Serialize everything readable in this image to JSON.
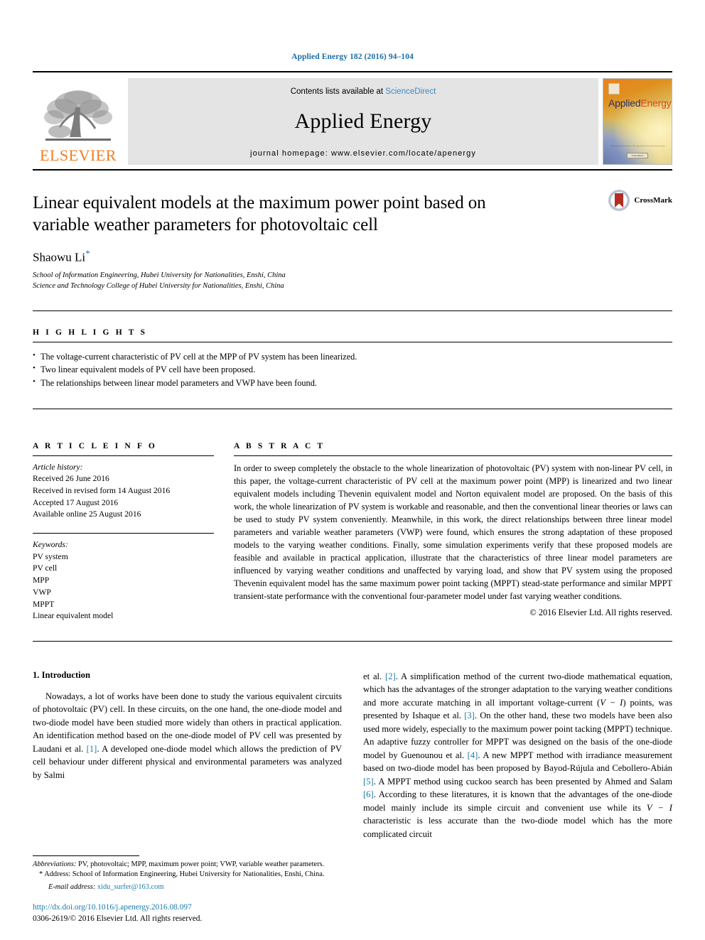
{
  "running_head": "Applied Energy 182 (2016) 94–104",
  "masthead": {
    "publisher_name": "ELSEVIER",
    "contents_prefix": "Contents lists available at ",
    "sciencedirect": "ScienceDirect",
    "journal_name": "Applied Energy",
    "homepage": "journal homepage: www.elsevier.com/locate/apenergy",
    "cover_title_part1": "Applied",
    "cover_title_part2": "Energy",
    "cover_footer_line1": "An International Journal of Energy Conversion and Conservation",
    "cover_footer_line2": "ScienceDirect"
  },
  "article": {
    "title": "Linear equivalent models at the maximum power point based on variable weather parameters for photovoltaic cell",
    "author": "Shaowu Li",
    "author_marker": "*",
    "affiliations": [
      "School of Information Engineering, Hubei University for Nationalities, Enshi, China",
      "Science and Technology College of Hubei University for Nationalities, Enshi, China"
    ],
    "crossmark_label": "CrossMark"
  },
  "highlights": {
    "heading": "H I G H L I G H T S",
    "items": [
      "The voltage-current characteristic of PV cell at the MPP of PV system has been linearized.",
      "Two linear equivalent models of PV cell have been proposed.",
      "The relationships between linear model parameters and VWP have been found."
    ]
  },
  "article_info": {
    "heading": "A R T I C L E   I N F O",
    "history_label": "Article history:",
    "history": [
      "Received 26 June 2016",
      "Received in revised form 14 August 2016",
      "Accepted 17 August 2016",
      "Available online 25 August 2016"
    ],
    "keywords_label": "Keywords:",
    "keywords": [
      "PV system",
      "PV cell",
      "MPP",
      "VWP",
      "MPPT",
      "Linear equivalent model"
    ]
  },
  "abstract": {
    "heading": "A B S T R A C T",
    "text": "In order to sweep completely the obstacle to the whole linearization of photovoltaic (PV) system with non-linear PV cell, in this paper, the voltage-current characteristic of PV cell at the maximum power point (MPP) is linearized and two linear equivalent models including Thevenin equivalent model and Norton equivalent model are proposed. On the basis of this work, the whole linearization of PV system is workable and reasonable, and then the conventional linear theories or laws can be used to study PV system conveniently. Meanwhile, in this work, the direct relationships between three linear model parameters and variable weather parameters (VWP) were found, which ensures the strong adaptation of these proposed models to the varying weather conditions. Finally, some simulation experiments verify that these proposed models are feasible and available in practical application, illustrate that the characteristics of three linear model parameters are influenced by varying weather conditions and unaffected by varying load, and show that PV system using the proposed Thevenin equivalent model has the same maximum power point tacking (MPPT) stead-state performance and similar MPPT transient-state performance with the conventional four-parameter model under fast varying weather conditions.",
    "copyright": "© 2016 Elsevier Ltd. All rights reserved."
  },
  "introduction": {
    "section_title": "1. Introduction",
    "left_text_a": "Nowadays, a lot of works have been done to study the various equivalent circuits of photovoltaic (PV) cell. In these circuits, on the one hand, the one-diode model and two-diode model have been studied more widely than others in practical application. An identification method based on the one-diode model of PV cell was presented by Laudani et al. ",
    "ref1": "[1]",
    "left_text_b": ". A developed one-diode model which allows the prediction of PV cell behaviour under different physical and environmental parameters was analyzed by Salmi",
    "right_text_a": "et al. ",
    "ref2": "[2]",
    "right_text_b": ". A simplification method of the current two-diode mathematical equation, which has the advantages of the stronger adaptation to the varying weather conditions and more accurate matching in all important voltage-current (",
    "formula_vi_1": "V − I",
    "right_text_c": ") points, was presented by Ishaque et al. ",
    "ref3": "[3]",
    "right_text_d": ". On the other hand, these two models have been also used more widely, especially to the maximum power point tacking (MPPT) technique. An adaptive fuzzy controller for MPPT was designed on the basis of the one-diode model by Guenounou et al. ",
    "ref4": "[4]",
    "right_text_e": ". A new MPPT method with irradiance measurement based on two-diode model has been proposed by Bayod-Rújula and Cebollero-Abián ",
    "ref5": "[5]",
    "right_text_f": ". A MPPT method using cuckoo search has been presented by Ahmed and Salam ",
    "ref6": "[6]",
    "right_text_g": ". According to these literatures, it is known that the advantages of the one-diode model mainly include its simple circuit and convenient use while its ",
    "formula_vi_2": "V − I",
    "right_text_h": " characteristic is less accurate than the two-diode model which has the more complicated circuit"
  },
  "footnotes": {
    "abbrev_label": "Abbreviations:",
    "abbrev_text": " PV, photovoltaic; MPP, maximum power point; VWP, variable weather parameters.",
    "address_marker": "*",
    "address_text": " Address: School of Information Engineering, Hubei University for Nationalities, Enshi, China.",
    "email_label": "E-mail address:",
    "email_value": "xidu_surfer@163.com",
    "doi": "http://dx.doi.org/10.1016/j.apenergy.2016.08.097",
    "issn_line": "0306-2619/© 2016 Elsevier Ltd. All rights reserved."
  },
  "colors": {
    "link_blue": "#1a7aa8",
    "running_head_blue": "#1a6ea8",
    "elsevier_orange": "#ef7d22",
    "band_gray": "#e4e4e4"
  }
}
